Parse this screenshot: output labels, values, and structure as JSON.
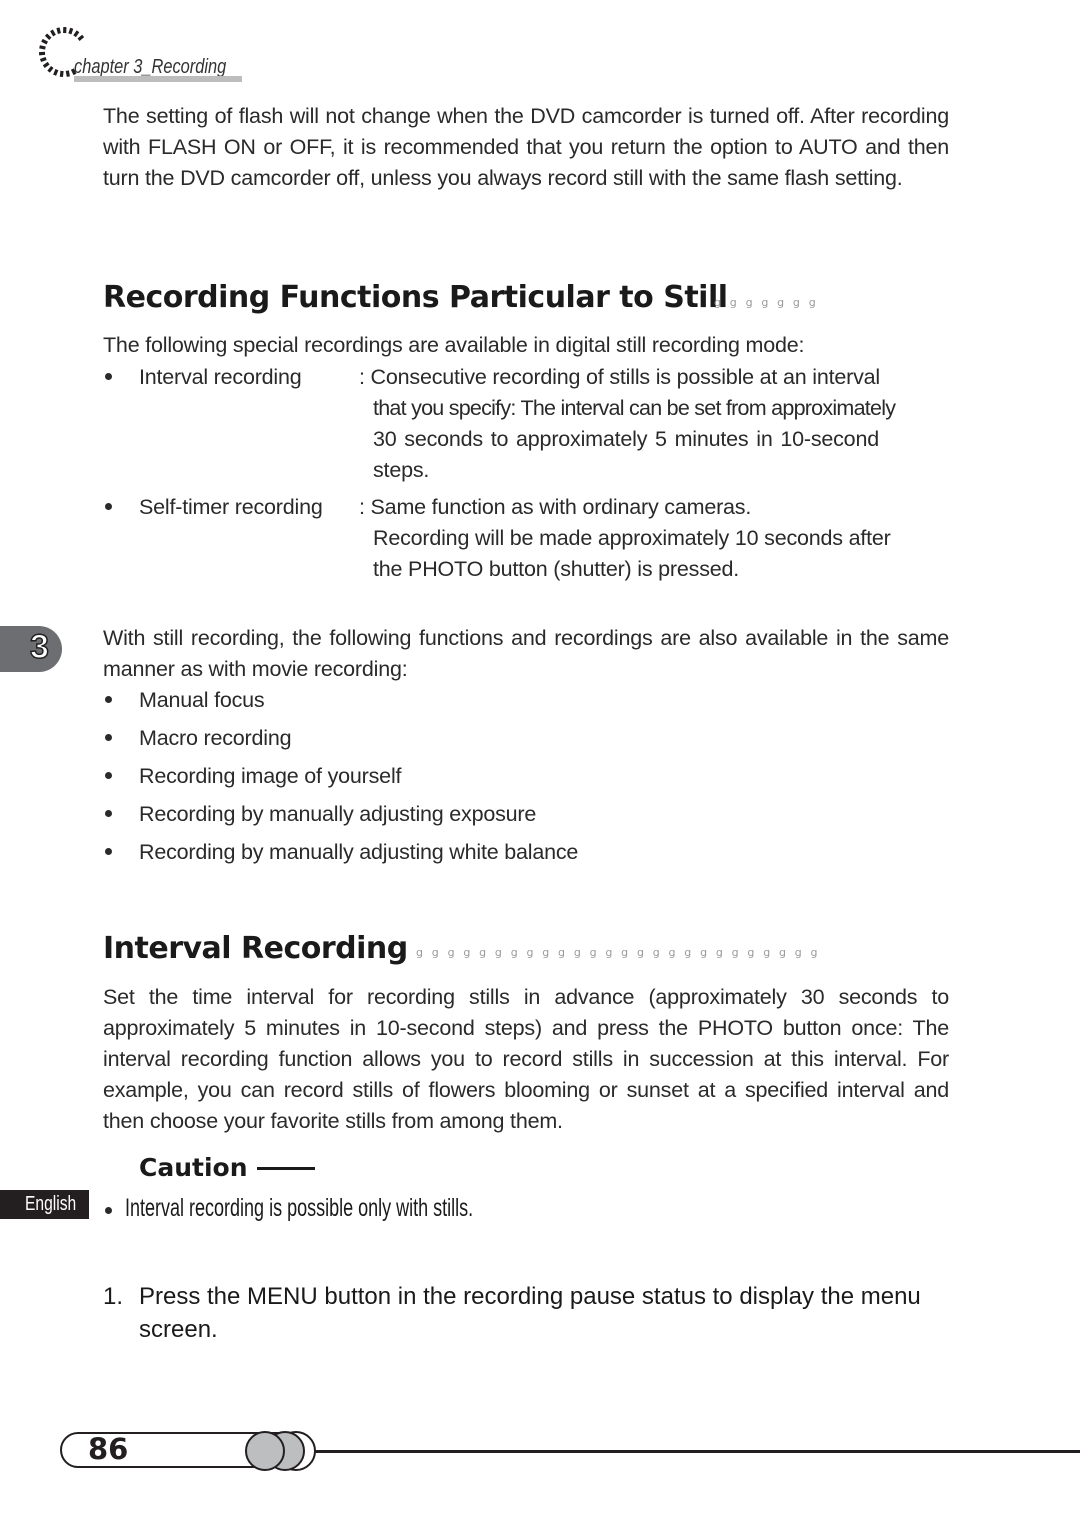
{
  "header": {
    "chapter_label": "chapter 3_Recording",
    "icon": "dotted-arc-icon"
  },
  "intro_paragraph": "The setting of flash will not change when the DVD camcorder is turned off. After recording with FLASH ON or OFF, it is recommended that you return the option to AUTO and then turn the DVD camcorder off, unless you always record still with the same flash setting.",
  "section1": {
    "heading": "Recording Functions Particular to Still",
    "leader": "ggggggg",
    "intro": "The following special recordings are available in digital still recording mode:",
    "definitions": [
      {
        "term": "Interval recording",
        "lines": [
          ": Consecutive recording of stills is possible at an interval",
          "that you specify: The interval can be set from approximately",
          "30 seconds to approximately 5 minutes in 10-second",
          "steps."
        ]
      },
      {
        "term": "Self-timer recording",
        "lines": [
          ": Same function as with ordinary cameras.",
          "Recording will be made approximately 10 seconds after",
          "the PHOTO button (shutter) is pressed."
        ]
      }
    ],
    "also_available_intro": "With still recording, the following functions and recordings are also available in the same manner as with movie recording:",
    "also_available": [
      "Manual focus",
      "Macro recording",
      "Recording image of yourself",
      "Recording by manually adjusting exposure",
      "Recording by manually adjusting white balance"
    ]
  },
  "section2": {
    "heading": "Interval Recording",
    "leader": "gggggggggggggggggggggggggg",
    "paragraph": "Set the time interval for recording stills in advance (approximately 30 seconds to approximately 5 minutes in 10-second steps) and press the PHOTO button once: The interval recording function allows you to record stills in succession at this interval. For example, you can record stills of flowers blooming or sunset at a specified interval and then choose your favorite stills from among them.",
    "caution": {
      "title": "Caution",
      "items": [
        "Interval recording is possible only with stills."
      ]
    },
    "steps": [
      {
        "number": "1.",
        "text": "Press the MENU button in the recording pause status to display the menu screen."
      }
    ]
  },
  "side_tabs": {
    "chapter_number": "3",
    "language": "English"
  },
  "footer": {
    "page_number": "86"
  },
  "colors": {
    "text": "#2a2a2a",
    "tab_gray": "#6d6e71",
    "underline_gray": "#bdbdbd",
    "ring_fill": "#bcbec0"
  }
}
